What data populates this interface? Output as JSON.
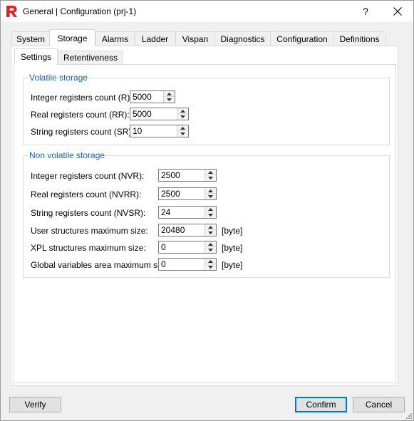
{
  "window": {
    "title": "General | Configuration (prj-1)",
    "help_label": "?",
    "brand_color": "#e02020"
  },
  "tabs": [
    "System",
    "Storage",
    "Alarms",
    "Ladder",
    "Vispan",
    "Diagnostics",
    "Configuration",
    "Definitions"
  ],
  "active_tab": "Storage",
  "subtabs": [
    "Settings",
    "Retentiveness"
  ],
  "active_subtab": "Settings",
  "volatile": {
    "title": "Volatile storage",
    "fields": [
      {
        "label": "Integer registers count (R):",
        "value": "5000"
      },
      {
        "label": "Real registers count (RR):",
        "value": "5000"
      },
      {
        "label": "String registers count (SR):",
        "value": "10"
      }
    ]
  },
  "non_volatile": {
    "title": "Non volatile storage",
    "fields": [
      {
        "label": "Integer registers count (NVR):",
        "value": "2500",
        "unit": ""
      },
      {
        "label": "Real registers count (NVRR):",
        "value": "2500",
        "unit": ""
      },
      {
        "label": "String registers count (NVSR):",
        "value": "24",
        "unit": ""
      },
      {
        "label": "User structures maximum size:",
        "value": "20480",
        "unit": "[byte]"
      },
      {
        "label": "XPL structures maximum size:",
        "value": "0",
        "unit": "[byte]"
      },
      {
        "label": "Global variables area maximum size:",
        "value": "0",
        "unit": "[byte]"
      }
    ]
  },
  "buttons": {
    "verify": "Verify",
    "confirm": "Confirm",
    "cancel": "Cancel"
  }
}
